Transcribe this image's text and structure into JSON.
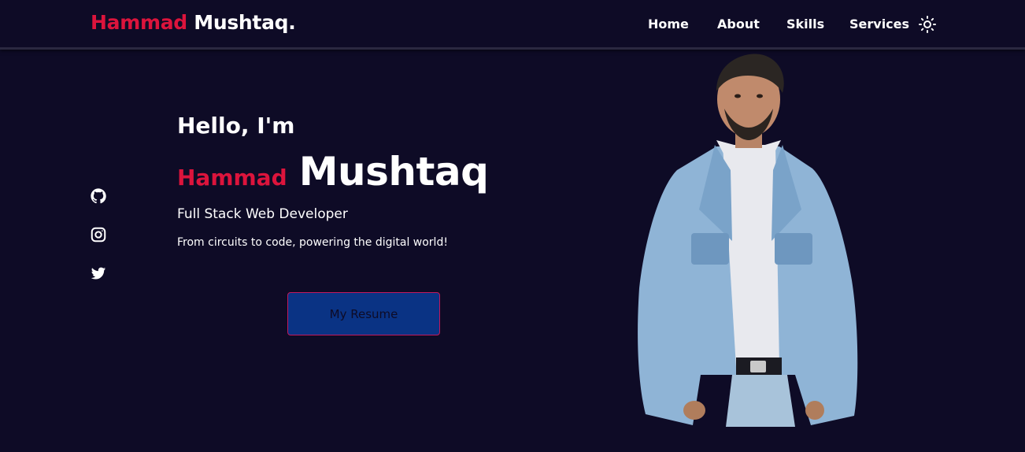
{
  "brand": {
    "first": "Hammad",
    "last": "Mushtaq."
  },
  "nav": {
    "items": [
      {
        "label": "Home"
      },
      {
        "label": "About"
      },
      {
        "label": "Skills"
      },
      {
        "label": "Services"
      }
    ],
    "theme_toggle_icon": "sun-icon"
  },
  "social": [
    {
      "icon": "github-icon"
    },
    {
      "icon": "instagram-icon"
    },
    {
      "icon": "twitter-icon"
    }
  ],
  "hero": {
    "greeting": "Hello, I'm",
    "first_name": "Hammad",
    "last_name": "Mushtaq",
    "role": "Full Stack Web Developer",
    "tagline": "From circuits to code, powering the digital world!",
    "resume_label": "My Resume"
  },
  "colors": {
    "background": "#0e0b26",
    "accent": "#dc143c",
    "button": "#0a3384",
    "button_border": "#c2185b"
  }
}
